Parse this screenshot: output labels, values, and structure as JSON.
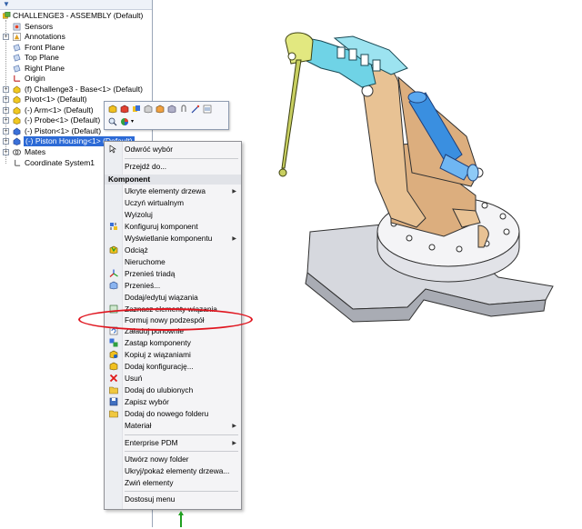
{
  "tree": {
    "items": [
      {
        "label": "CHALLENGE3 - ASSEMBLY  (Default)",
        "icon": "assembly-icon"
      },
      {
        "label": "Sensors",
        "icon": "sensors-icon"
      },
      {
        "label": "Annotations",
        "icon": "annotations-icon"
      },
      {
        "label": "Front Plane",
        "icon": "plane-icon"
      },
      {
        "label": "Top Plane",
        "icon": "plane-icon"
      },
      {
        "label": "Right Plane",
        "icon": "plane-icon"
      },
      {
        "label": "Origin",
        "icon": "origin-icon"
      },
      {
        "label": "(f) Challenge3 - Base<1> (Default)",
        "icon": "part-icon"
      },
      {
        "label": "Pivot<1> (Default)",
        "icon": "part-icon"
      },
      {
        "label": "(-) Arm<1> (Default)",
        "icon": "part-icon"
      },
      {
        "label": "(-) Probe<1> (Default)",
        "icon": "part-icon"
      },
      {
        "label": "(-) Piston<1> (Default)",
        "icon": "part-icon"
      },
      {
        "label": "(-) Piston Housing<1> (Default)",
        "icon": "part-icon"
      },
      {
        "label": "Mates",
        "icon": "mates-icon"
      },
      {
        "label": "Coordinate System1",
        "icon": "coordinate-system-icon"
      }
    ]
  },
  "context_menu": {
    "top_items": [
      {
        "label": "Odwróć wybór"
      },
      {
        "label": "Przejdź do..."
      }
    ],
    "section_header": "Komponent",
    "section_items": [
      {
        "label": "Ukryte elementy drzewa",
        "submenu": true
      },
      {
        "label": "Uczyń wirtualnym"
      },
      {
        "label": "Wyizoluj"
      },
      {
        "label": "Konfiguruj komponent"
      },
      {
        "label": "Wyświetlanie komponentu",
        "submenu": true
      },
      {
        "label": "Odciąż"
      },
      {
        "label": "Nieruchome"
      },
      {
        "label": "Przenieś triadą"
      },
      {
        "label": "Przenieś..."
      },
      {
        "label": "Dodaj/edytuj wiązania"
      },
      {
        "label": "Zaznacz elementy wiązania"
      },
      {
        "label": "Formuj nowy podzespół"
      },
      {
        "label": "Załaduj ponownie"
      },
      {
        "label": "Zastąp komponenty"
      },
      {
        "label": "Kopiuj z wiązaniami"
      },
      {
        "label": "Dodaj konfigurację..."
      },
      {
        "label": "Usuń"
      },
      {
        "label": "Dodaj do ulubionych"
      },
      {
        "label": "Zapisz wybór"
      },
      {
        "label": "Dodaj do nowego folderu"
      },
      {
        "label": "Materiał",
        "submenu": true
      }
    ],
    "pdm_item": {
      "label": "Enterprise PDM",
      "submenu": true
    },
    "folder_items": [
      {
        "label": "Utwórz nowy folder"
      },
      {
        "label": "Ukryj/pokaż elementy drzewa..."
      },
      {
        "label": "Zwiń elementy"
      }
    ],
    "customize_item": {
      "label": "Dostosuj menu"
    }
  },
  "colors": {
    "selection": "#2c6ad6",
    "highlight_ellipse": "#e0141e",
    "arm_cyan": "#6fd3e6",
    "housing_tan": "#dcae7e",
    "piston_blue": "#3a8fe0",
    "base_gray": "#d6d8de"
  }
}
